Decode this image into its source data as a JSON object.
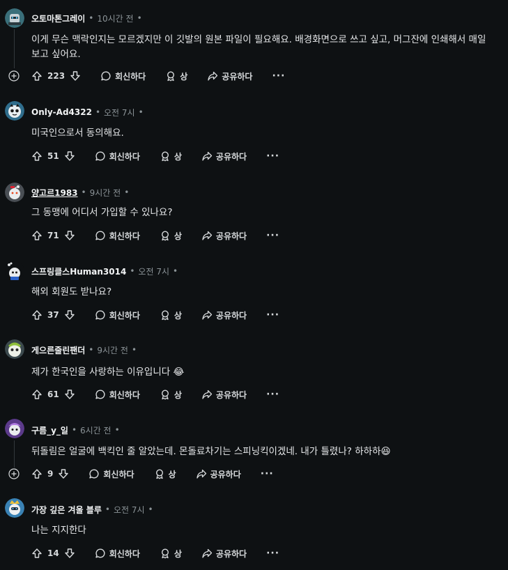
{
  "labels": {
    "reply": "회신하다",
    "award": "상",
    "share": "공유하다",
    "more": "···"
  },
  "comments": [
    {
      "author": "오토마톤그레이",
      "time": "10시간 전",
      "body": "이게 무슨 맥락인지는 모르겠지만 이 깃발의 원본 파일이 필요해요. 배경화면으로 쓰고 싶고, 머그잔에 인쇄해서 매일 보고 싶어요.",
      "votes": "223"
    },
    {
      "author": "Only-Ad4322",
      "time": "오전 7시",
      "body": "미국인으로서 동의해요.",
      "votes": "51"
    },
    {
      "author": "양고르1983",
      "time": "9시간 전",
      "body": "그 동맹에 어디서 가입할 수 있나요?",
      "votes": "71"
    },
    {
      "author": "스프링클스Human3014",
      "time": "오전 7시",
      "body": "해외 회원도 받나요?",
      "votes": "37"
    },
    {
      "author": "게으른줄린팬더",
      "time": "9시간 전",
      "body": "제가 한국인을 사랑하는 이유입니다 😂",
      "votes": "61"
    },
    {
      "author": "구름_y_일",
      "time": "6시간 전",
      "body": "뒤돌림은 얼굴에 백킥인 줄 알았는데. 몬돌료차기는 스피닝킥이겠네. 내가 틀렸나? 하하하😆",
      "votes": "9"
    },
    {
      "author": "가장 깊은 겨울 블루",
      "time": "오전 7시",
      "body": "나는 지지한다",
      "votes": "14"
    }
  ]
}
